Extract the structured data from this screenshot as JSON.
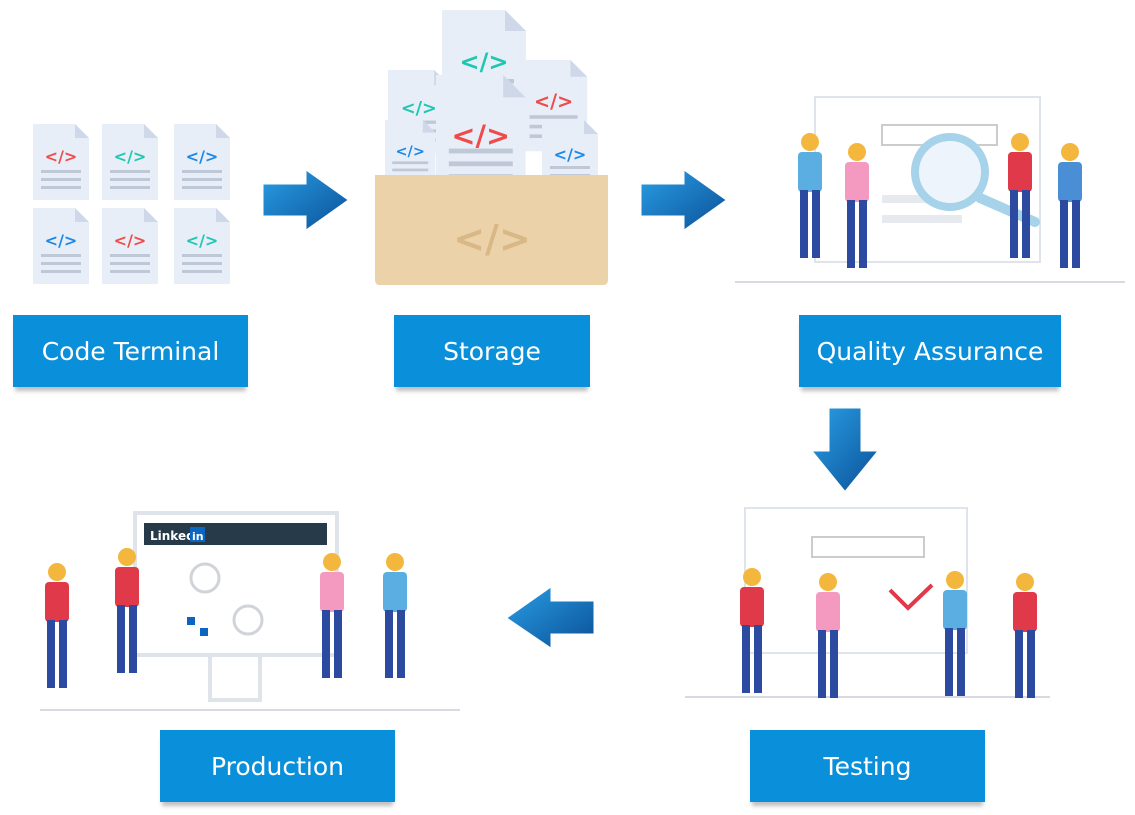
{
  "stages": [
    {
      "id": "code-terminal",
      "label": "Code Terminal"
    },
    {
      "id": "storage",
      "label": "Storage"
    },
    {
      "id": "quality-assurance",
      "label": "Quality Assurance"
    },
    {
      "id": "testing",
      "label": "Testing"
    },
    {
      "id": "production",
      "label": "Production"
    }
  ],
  "flow": [
    "Code Terminal",
    "Storage",
    "Quality Assurance",
    "Testing",
    "Production"
  ],
  "code_symbol": "</>",
  "production_screen_brand": "Linked in",
  "colors": {
    "label_bg": "#0a8fdb",
    "arrow": "#0a6fb8",
    "code_red": "#f04b4b",
    "code_teal": "#1ec8b0",
    "code_blue": "#1e88e5",
    "folder": "#ecd2a8"
  }
}
